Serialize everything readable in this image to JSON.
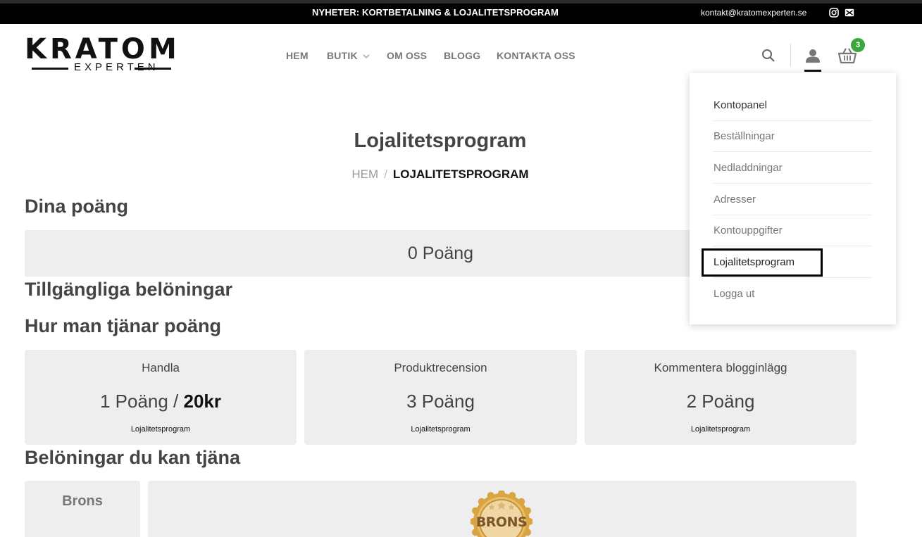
{
  "topbar": {
    "announcement": "NYHETER: KORTBETALNING & LOJALITETSPROGRAM",
    "email": "kontakt@kratomexperten.se",
    "icons": [
      "instagram-icon",
      "mail-icon"
    ]
  },
  "logo": {
    "word": "KRATOM",
    "sub": "EXPERTEN"
  },
  "nav": {
    "items": [
      "HEM",
      "BUTIK",
      "OM OSS",
      "BLOGG",
      "KONTAKTA OSS"
    ]
  },
  "header": {
    "cart_count": "3",
    "accent": "#3aa83a"
  },
  "page": {
    "title": "Lojalitetsprogram",
    "breadcrumb_home": "HEM",
    "breadcrumb_sep": "/",
    "breadcrumb_current": "LOJALITETSPROGRAM"
  },
  "sections": {
    "your_points": "Dina poäng",
    "available_rewards": "Tillgängliga belöningar",
    "how_to_earn": "Hur man tjänar poäng",
    "rewards_to_earn": "Belöningar du kan tjäna"
  },
  "points": {
    "value": "0 Poäng"
  },
  "earn_cards": [
    {
      "title": "Handla",
      "value_prefix": "1 Poäng / ",
      "value_bold": "20kr",
      "footer": "Lojalitetsprogram"
    },
    {
      "title": "Produktrecension",
      "value_prefix": "3 Poäng",
      "value_bold": "",
      "footer": "Lojalitetsprogram"
    },
    {
      "title": "Kommentera blogginlägg",
      "value_prefix": "2 Poäng",
      "value_bold": "",
      "footer": "Lojalitetsprogram"
    }
  ],
  "rewards": {
    "tier": "Brons",
    "badge_text": "BRONS"
  },
  "account_menu": {
    "items": [
      "Kontopanel",
      "Beställningar",
      "Nedladdningar",
      "Adresser",
      "Kontouppgifter",
      "Lojalitetsprogram",
      "Logga ut"
    ],
    "selected": "Lojalitetsprogram"
  }
}
